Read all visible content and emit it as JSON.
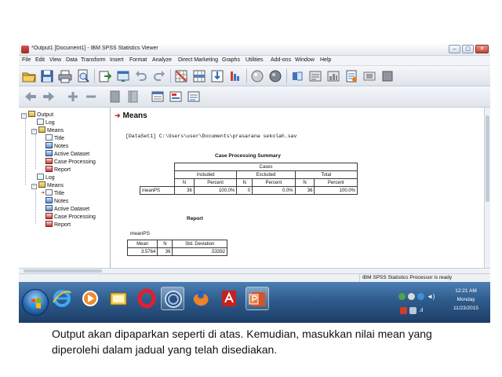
{
  "window": {
    "title": "*Output1 [Document1] - IBM SPSS Statistics Viewer",
    "minimize_glyph": "–",
    "maximize_glyph": "▢",
    "close_glyph": "✕"
  },
  "menu": [
    "File",
    "Edit",
    "View",
    "Data",
    "Transform",
    "Insert",
    "Format",
    "Analyze",
    "Direct Marketing",
    "Graphs",
    "Utilities",
    "Add-ons",
    "Window",
    "Help"
  ],
  "toolbar1": [
    "open-folder-icon",
    "save-icon",
    "print-icon",
    "print-preview-icon",
    "export-icon",
    "recall-dialog-icon",
    "undo-icon",
    "redo-icon",
    "goto-data-icon",
    "goto-case-icon",
    "goto-variable-icon",
    "variables-icon",
    "create-title-icon",
    "create-text-icon",
    "designate-window-icon",
    "insert-heading-icon",
    "insert-chart-icon",
    "script-icon",
    "bookmark-icon",
    "stop-icon"
  ],
  "toolbar2": [
    "back-arrow-icon",
    "forward-arrow-icon",
    "expand-icon",
    "collapse-icon",
    "show-icon",
    "hide-icon",
    "insert-heading-icon",
    "insert-title-icon",
    "insert-text-icon"
  ],
  "outline": [
    {
      "label": "Output",
      "icon": "output-book-icon",
      "expander": "−"
    },
    {
      "label": "Log",
      "icon": "log-icon",
      "expander": ""
    },
    {
      "label": "Means",
      "icon": "procedure-icon",
      "expander": "−"
    },
    {
      "label": "Title",
      "icon": "title-icon",
      "expander": ""
    },
    {
      "label": "Notes",
      "icon": "notes-icon",
      "expander": ""
    },
    {
      "label": "Active Dataset",
      "icon": "dataset-icon",
      "expander": ""
    },
    {
      "label": "Case Processing",
      "icon": "table-icon",
      "expander": ""
    },
    {
      "label": "Report",
      "icon": "table-icon",
      "expander": ""
    },
    {
      "label": "Log",
      "icon": "log-icon",
      "expander": ""
    },
    {
      "label": "Means",
      "icon": "procedure-icon",
      "expander": "−"
    },
    {
      "label": "Title",
      "icon": "title-icon",
      "expander": ""
    },
    {
      "label": "Notes",
      "icon": "notes-icon",
      "expander": ""
    },
    {
      "label": "Active Dataset",
      "icon": "dataset-icon",
      "expander": ""
    },
    {
      "label": "Case Processing",
      "icon": "table-icon",
      "expander": ""
    },
    {
      "label": "Report",
      "icon": "table-icon",
      "expander": ""
    }
  ],
  "output": {
    "heading": "Means",
    "dataset_line": "[DataSet1] C:\\Users\\user\\Documents\\prasarana sekolah.sav",
    "case_processing": {
      "title": "Case Processing Summary",
      "group_header": "Cases",
      "groups": [
        "Included",
        "Excluded",
        "Total"
      ],
      "subheaders": [
        "N",
        "Percent",
        "N",
        "Percent",
        "N",
        "Percent"
      ],
      "row_label": "meanPS",
      "row_values": [
        "36",
        "100.0%",
        "0",
        "0.0%",
        "36",
        "100.0%"
      ]
    },
    "report": {
      "title": "Report",
      "variable": "meanPS",
      "headers": [
        "Mean",
        "N",
        "Std. Deviation"
      ],
      "values": [
        "3.5764",
        "36",
        ".53392"
      ]
    }
  },
  "status": {
    "processor": "IBM SPSS Statistics Processor is ready"
  },
  "taskbar": {
    "apps": [
      "internet-explorer-icon",
      "media-player-icon",
      "file-explorer-icon",
      "opera-icon",
      "spss-icon",
      "firefox-icon",
      "acrobat-icon",
      "powerpoint-icon"
    ],
    "clock_time": "12:21 AM",
    "clock_day": "Monday",
    "clock_date": "11/23/2015"
  },
  "caption": "Output akan dipaparkan seperti di atas. Kemudian, masukkan nilai mean yang diperolehi dalam jadual yang telah disediakan.",
  "colors": {
    "taskbar": "#2e5b8c",
    "heading_arrow": "#c0282d",
    "titlebar": "#e4e9f1"
  }
}
